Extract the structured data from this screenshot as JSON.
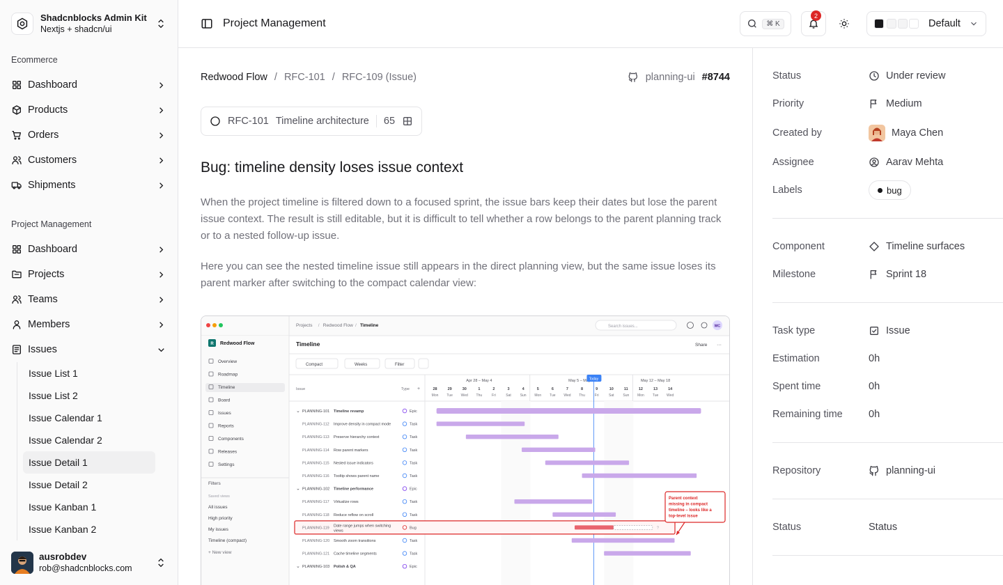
{
  "brand": {
    "name": "Shadcnblocks Admin Kit",
    "sub": "Nextjs + shadcn/ui"
  },
  "nav": {
    "groups": [
      {
        "label": "Ecommerce",
        "items": [
          {
            "label": "Dashboard",
            "icon": "grid-icon"
          },
          {
            "label": "Products",
            "icon": "box-icon"
          },
          {
            "label": "Orders",
            "icon": "cart-icon"
          },
          {
            "label": "Customers",
            "icon": "users-icon"
          },
          {
            "label": "Shipments",
            "icon": "truck-icon"
          }
        ]
      },
      {
        "label": "Project Management",
        "items": [
          {
            "label": "Dashboard",
            "icon": "grid-icon"
          },
          {
            "label": "Projects",
            "icon": "folder-icon"
          },
          {
            "label": "Teams",
            "icon": "users-icon"
          },
          {
            "label": "Members",
            "icon": "user-icon"
          },
          {
            "label": "Issues",
            "icon": "list-icon"
          }
        ]
      }
    ],
    "issue_sub": [
      "Issue List 1",
      "Issue List 2",
      "Issue Calendar 1",
      "Issue Calendar 2",
      "Issue Detail 1",
      "Issue Detail 2",
      "Issue Kanban 1",
      "Issue Kanban 2"
    ],
    "active_sub": "Issue Detail 1"
  },
  "user": {
    "name": "ausrobdev",
    "email": "rob@shadcnblocks.com"
  },
  "topbar": {
    "title": "Project Management",
    "search_kbd": "⌘ K",
    "notif_count": "2",
    "theme_label": "Default"
  },
  "breadcrumb": {
    "items": [
      "Redwood Flow",
      "RFC-101",
      "RFC-109 (Issue)"
    ],
    "repo": "planning-ui",
    "pr": "#8744"
  },
  "parent": {
    "id": "RFC-101",
    "title": "Timeline architecture",
    "count": "65"
  },
  "issue": {
    "title": "Bug: timeline density loses issue context",
    "para1": "When the project timeline is filtered down to a focused sprint, the issue bars keep their dates but lose the parent issue context. The result is still editable, but it is difficult to tell whether a row belongs to the parent planning track or to a nested follow-up issue.",
    "para2": "Here you can see the nested timeline issue still appears in the direct planning view, but the same issue loses its parent marker after switching to the compact calendar view:"
  },
  "screenshot": {
    "crumbs": [
      "Projects",
      "Redwood Flow",
      "Timeline"
    ],
    "search": "Search issues...",
    "initials": "MC",
    "project": "Redwood Flow",
    "project_badge": "R",
    "side": [
      "Overview",
      "Roadmap",
      "Timeline",
      "Board",
      "Issues",
      "Reports",
      "Components",
      "Releases",
      "Settings"
    ],
    "filters_label": "Filters",
    "saved_views": "Saved views",
    "views": [
      "All issues",
      "High priority",
      "My issues",
      "Timeline (compact)"
    ],
    "new_view": "+ New view",
    "heading": "Timeline",
    "share": "Share",
    "toolbar": [
      "Compact",
      "Weeks",
      "Filter"
    ],
    "col_issue": "Issue",
    "col_type": "Type",
    "ranges": [
      "Apr 28 – May 4",
      "May 5 – May 11",
      "May 12 – May 18"
    ],
    "today": "Today",
    "days": [
      [
        "28",
        "Mon"
      ],
      [
        "29",
        "Tue"
      ],
      [
        "30",
        "Wed"
      ],
      [
        "1",
        "Thu"
      ],
      [
        "2",
        "Fri"
      ],
      [
        "3",
        "Sat"
      ],
      [
        "4",
        "Sun"
      ],
      [
        "5",
        "Mon"
      ],
      [
        "6",
        "Tue"
      ],
      [
        "7",
        "Wed"
      ],
      [
        "8",
        "Thu"
      ],
      [
        "9",
        "Fri"
      ],
      [
        "10",
        "Sat"
      ],
      [
        "11",
        "Sun"
      ],
      [
        "12",
        "Mon"
      ],
      [
        "13",
        "Tue"
      ],
      [
        "14",
        "Wed"
      ]
    ],
    "rows": [
      {
        "id": "PLANNING-101",
        "title": "Timeline revamp",
        "type": "Epic",
        "epic": true,
        "start": 0.6,
        "end": 18.6
      },
      {
        "id": "PLANNING-112",
        "title": "Improve density in compact mode",
        "type": "Task",
        "start": 0.6,
        "end": 6.6
      },
      {
        "id": "PLANNING-113",
        "title": "Preserve hierarchy context",
        "type": "Task",
        "start": 2.6,
        "end": 8.9
      },
      {
        "id": "PLANNING-114",
        "title": "Row parent markers",
        "type": "Task",
        "start": 6.4,
        "end": 11.4
      },
      {
        "id": "PLANNING-115",
        "title": "Nested issue indicators",
        "type": "Task",
        "start": 8.0,
        "end": 13.7
      },
      {
        "id": "PLANNING-116",
        "title": "Tooltip shows parent name",
        "type": "Task",
        "start": 10.5,
        "end": 18.3
      },
      {
        "id": "PLANNING-102",
        "title": "Timeline performance",
        "type": "Epic",
        "epic": true
      },
      {
        "id": "PLANNING-117",
        "title": "Virtualize rows",
        "type": "Task",
        "start": 5.9,
        "end": 11.2
      },
      {
        "id": "PLANNING-118",
        "title": "Reduce reflow on scroll",
        "type": "Task",
        "start": 8.5,
        "end": 12.8
      },
      {
        "id": "PLANNING-119",
        "title": "Date range jumps when switching views",
        "type": "Bug",
        "bug": true,
        "start": 10.0,
        "end": 15.3
      },
      {
        "id": "PLANNING-120",
        "title": "Smooth zoom transitions",
        "type": "Task",
        "start": 9.8,
        "end": 16.8
      },
      {
        "id": "PLANNING-121",
        "title": "Cache timeline segments",
        "type": "Task",
        "start": 12.0,
        "end": 17.9
      },
      {
        "id": "PLANNING-103",
        "title": "Polish & QA",
        "type": "Epic",
        "epic": true
      }
    ],
    "callout": "Parent context missing in compact timeline – looks like a top-level issue"
  },
  "details": {
    "s1": [
      {
        "k": "Status",
        "v": "Under review",
        "icon": "clock-icon"
      },
      {
        "k": "Priority",
        "v": "Medium",
        "icon": "flag-icon"
      },
      {
        "k": "Created by",
        "v": "Maya Chen",
        "icon": "avatar"
      },
      {
        "k": "Assignee",
        "v": "Aarav Mehta",
        "icon": "user-circle-icon"
      },
      {
        "k": "Labels",
        "v": "bug",
        "icon": "pill"
      }
    ],
    "s2": [
      {
        "k": "Component",
        "v": "Timeline surfaces",
        "icon": "diamond-icon"
      },
      {
        "k": "Milestone",
        "v": "Sprint 18",
        "icon": "flag-icon"
      }
    ],
    "s3": [
      {
        "k": "Task type",
        "v": "Issue",
        "icon": "checkbox-icon"
      },
      {
        "k": "Estimation",
        "v": "0h"
      },
      {
        "k": "Spent time",
        "v": "0h"
      },
      {
        "k": "Remaining time",
        "v": "0h"
      }
    ],
    "s4": [
      {
        "k": "Repository",
        "v": "planning-ui",
        "icon": "github-icon"
      }
    ],
    "s5": [
      {
        "k": "Status",
        "v": "Status"
      }
    ]
  },
  "colors": {
    "bar": "#c9a8ea",
    "bug": "#e9646e",
    "accent": "#3b82f6",
    "callout": "#dc2626"
  }
}
